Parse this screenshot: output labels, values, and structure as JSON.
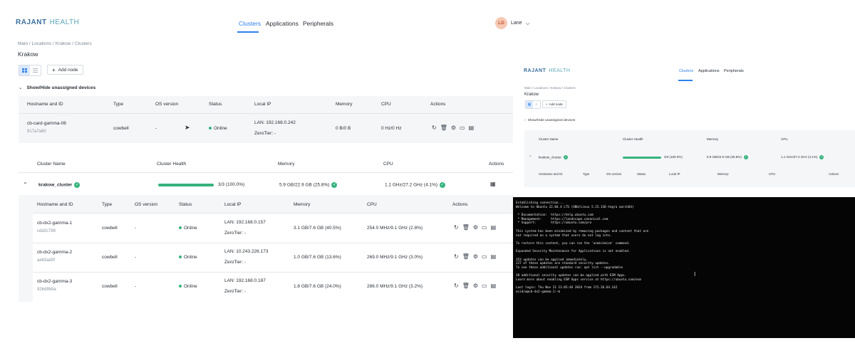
{
  "brand": {
    "name": "RAJANT",
    "product": "HEALTH"
  },
  "nav": {
    "items": [
      "Clusters",
      "Applications",
      "Peripherals"
    ]
  },
  "user": {
    "initials": "LD",
    "name": "Lane"
  },
  "breadcrumb": "Main / Locations / Krakow / Clusters",
  "page_title": "Krakow",
  "toolbar": {
    "add_node": "Add node"
  },
  "unassigned_toggle": "Show/Hide unassigned devices",
  "device_columns": [
    "Hostname and ID",
    "Type",
    "OS version",
    "Status",
    "Local IP",
    "Memory",
    "CPU",
    "Actions"
  ],
  "unassigned_device": {
    "hostname": "cb-card-gamma-06",
    "id": "917a7a60",
    "type": "cowbell",
    "os": "-",
    "status": "Online",
    "lan": "LAN: 192.168.0.242",
    "zerotier": "ZeroTier: -",
    "memory": "0 B/0 B",
    "cpu": "0 Hz/0 Hz"
  },
  "cluster_columns": [
    "Cluster Name",
    "Cluster Health",
    "Memory",
    "CPU",
    "Actions"
  ],
  "cluster": {
    "name": "krakow_cluster",
    "health_text": "3/3 (100.0%)",
    "health_fraction": 1.0,
    "memory": "5.9 GB/22.9 GB (25.8%)",
    "cpu": "1.1 GHz/27.2 GHz (4.1%)"
  },
  "cluster_nodes": [
    {
      "hostname": "cb-dx2-gamma-1",
      "id": "cdd2c789",
      "type": "cowbell",
      "os": "-",
      "status": "Online",
      "lan": "LAN: 192.168.0.157",
      "zerotier": "ZeroTier: -",
      "memory": "3.1 GB/7.6 GB (40.5%)",
      "cpu": "254.0 MHz/9.1 GHz (2.8%)"
    },
    {
      "hostname": "cb-dx2-gamma-2",
      "id": "ae63ad3f",
      "type": "cowbell",
      "os": "-",
      "status": "Online",
      "lan": "LAN: 10.243.226.173",
      "zerotier": "ZeroTier: -",
      "memory": "1.0 GB/7.6 GB (13.6%)",
      "cpu": "269.0 MHz/9.1 GHz (3.0%)"
    },
    {
      "hostname": "cb-dx2-gamma-3",
      "id": "926d9b9a",
      "type": "cowbell",
      "os": "-",
      "status": "Online",
      "lan": "LAN: 192.168.0.187",
      "zerotier": "ZeroTier: -",
      "memory": "1.8 GB/7.6 GB (24.0%)",
      "cpu": "286.0 MHz/9.1 GHz (3.2%)"
    }
  ],
  "mini": {
    "cluster_columns": [
      "Cluster Name",
      "Cluster Health",
      "Memory",
      "CPU"
    ],
    "cluster": {
      "name": "krakow_cluster",
      "health_text": "3/3 (100.0%)",
      "memory": "5.9 GB/22.9 GB (25.8%)",
      "cpu": "1.1 GHz/27.2 GHz (4.1%)"
    },
    "node_columns": [
      "Hostname and ID",
      "Type",
      "OS version",
      "Status",
      "Local IP",
      "Memory",
      "CPU",
      "Actions"
    ]
  },
  "terminal": {
    "lines": [
      "Establishing connection...",
      "Welcome to Ubuntu 22.04.4 LTS (GNU/Linux 5.15.136-tegra aarch64)",
      "",
      " * Documentation:  https://help.ubuntu.com",
      " * Management:     https://landscape.canonical.com",
      " * Support:        https://ubuntu.com/pro",
      "",
      "This system has been minimized by removing packages and content that are",
      "not required on a system that users do not log into.",
      "",
      "To restore this content, you can run the 'unminimize' command.",
      "",
      "Expanded Security Maintenance for Applications is not enabled.",
      "",
      "353 updates can be applied immediately.",
      "227 of these updates are standard security updates.",
      "To see these additional updates run: apt list --upgradable",
      "",
      "38 additional security updates can be applied with ESM Apps.",
      "Learn more about enabling ESM Apps service at https://ubuntu.com/esm",
      "",
      "Last login: Thu Nov 21 11:05:46 2024 from 172.26.64.142",
      "acidia@cb-dx2-gamma-1:~$"
    ]
  }
}
